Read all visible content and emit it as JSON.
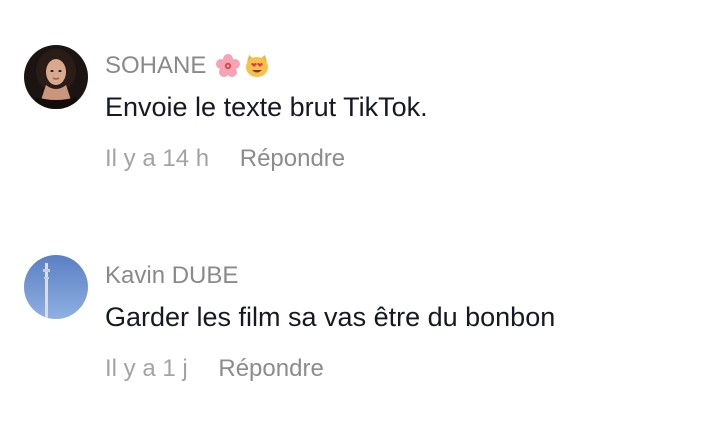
{
  "comments": [
    {
      "username": "SOHANE",
      "emojis": [
        "hibiscus-emoji",
        "smiling-cat-heart-eyes-emoji"
      ],
      "text": "Envoie le texte brut TikTok.",
      "time": "Il y a 14 h",
      "reply_label": "Répondre",
      "avatar_icon": "user-avatar-photo"
    },
    {
      "username": "Kavin DUBE",
      "text": "Garder les film sa vas être du bonbon",
      "time": "Il y a 1 j",
      "reply_label": "Répondre",
      "avatar_icon": "sky-pole-avatar-photo"
    }
  ],
  "colors": {
    "username": "#8a8a8a",
    "text": "#161823",
    "meta": "#9a9a9a",
    "background": "#ffffff"
  }
}
